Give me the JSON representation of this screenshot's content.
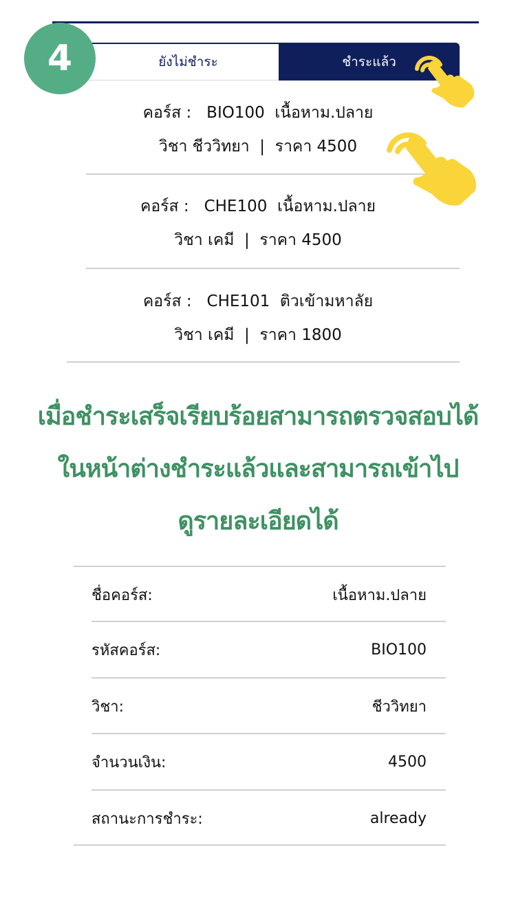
{
  "step": {
    "number": "4"
  },
  "tabs": {
    "unpaid": "ยังไม่ชำระ",
    "paid": "ชำระแล้ว",
    "active": "paid"
  },
  "courses": [
    {
      "line1": "คอร์ส :   BIO100  เนื้อหาม.ปลาย",
      "line2": "วิชา ชีววิทยา  |  ราคา 4500"
    },
    {
      "line1": "คอร์ส :   CHE100  เนื้อหาม.ปลาย",
      "line2": "วิชา เคมี  |  ราคา 4500"
    },
    {
      "line1": "คอร์ส :   CHE101  ติวเข้ามหาลัย",
      "line2": "วิชา เคมี  |  ราคา 1800"
    }
  ],
  "instruction": {
    "line1": "เมื่อชำระเสร็จเรียบร้อยสามารถตรวจสอบได้",
    "line2": "ในหน้าต่างชำระแล้วและสามารถเข้าไป",
    "line3": "ดูรายละเอียดได้"
  },
  "details": [
    {
      "label": "ชื่อคอร์ส:",
      "value": "เนื้อหาม.ปลาย"
    },
    {
      "label": "รหัสคอร์ส:",
      "value": "BIO100"
    },
    {
      "label": "วิชา:",
      "value": "ชีววิทยา"
    },
    {
      "label": "จำนวนเงิน:",
      "value": "4500"
    },
    {
      "label": "สถานะการชำระ:",
      "value": "already"
    }
  ],
  "colors": {
    "navy": "#0f1f5c",
    "green_badge": "#55ad85",
    "green_text": "#3e9163",
    "hand_yellow": "#f9d53a",
    "divider": "#d0d0d0"
  },
  "icons": [
    "tap-hand-icon",
    "tap-hand-icon"
  ]
}
